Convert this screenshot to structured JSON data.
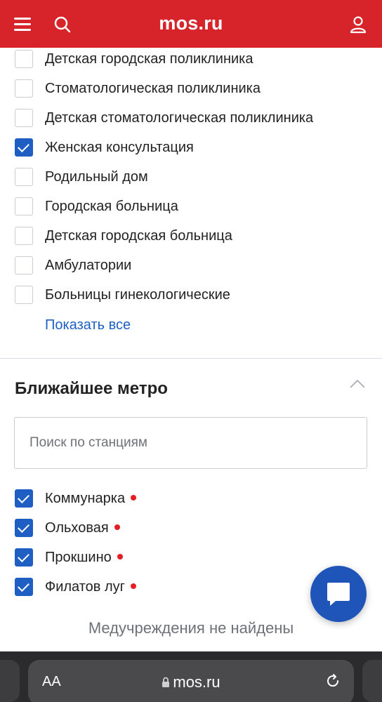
{
  "header": {
    "logo": "mos.ru",
    "icons": [
      "menu-icon",
      "search-icon",
      "user-icon"
    ],
    "color": "#d6242a"
  },
  "facility_types": {
    "items": [
      {
        "label": "Детская городская поликлиника",
        "checked": false
      },
      {
        "label": "Стоматологическая поликлиника",
        "checked": false
      },
      {
        "label": "Детская стоматологическая поликлиника",
        "checked": false
      },
      {
        "label": "Женская консультация",
        "checked": true
      },
      {
        "label": "Родильный дом",
        "checked": false
      },
      {
        "label": "Городская больница",
        "checked": false
      },
      {
        "label": "Детская городская больница",
        "checked": false
      },
      {
        "label": "Амбулатории",
        "checked": false
      },
      {
        "label": "Больницы гинекологические",
        "checked": false
      }
    ],
    "show_all": "Показать все"
  },
  "metro": {
    "title": "Ближайшее метро",
    "search_placeholder": "Поиск по станциям",
    "stations": [
      {
        "label": "Коммунарка",
        "checked": true,
        "line_color": "#e31e24"
      },
      {
        "label": "Ольховая",
        "checked": true,
        "line_color": "#e31e24"
      },
      {
        "label": "Прокшино",
        "checked": true,
        "line_color": "#e31e24"
      },
      {
        "label": "Филатов луг",
        "checked": true,
        "line_color": "#e31e24"
      }
    ]
  },
  "results": {
    "empty_message": "Медучреждения не найдены"
  },
  "chat": {
    "icon": "chat-icon",
    "color": "#1f54b8"
  },
  "browser": {
    "text_size": "AA",
    "url": "mos.ru",
    "icons": [
      "lock-icon",
      "reload-icon"
    ]
  }
}
